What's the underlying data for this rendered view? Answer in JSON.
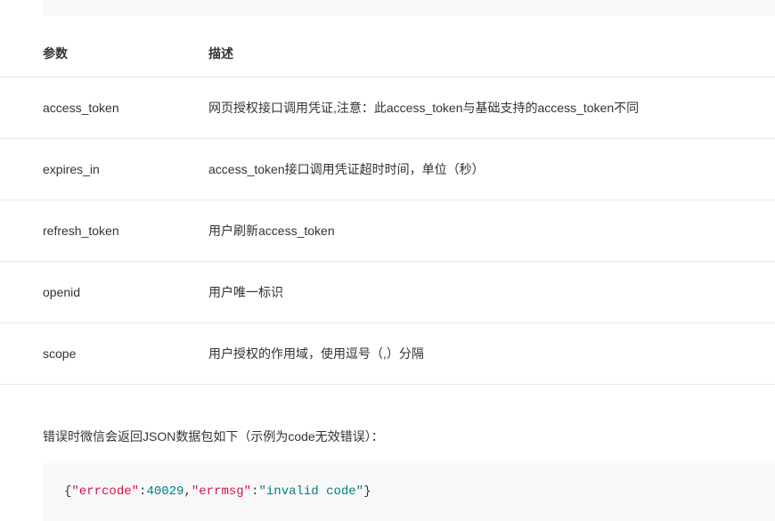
{
  "table": {
    "header": {
      "param": "参数",
      "desc": "描述"
    },
    "rows": [
      {
        "param": "access_token",
        "desc": "网页授权接口调用凭证,注意：此access_token与基础支持的access_token不同"
      },
      {
        "param": "expires_in",
        "desc": "access_token接口调用凭证超时时间，单位（秒）"
      },
      {
        "param": "refresh_token",
        "desc": "用户刷新access_token"
      },
      {
        "param": "openid",
        "desc": "用户唯一标识"
      },
      {
        "param": "scope",
        "desc": "用户授权的作用域，使用逗号（,）分隔"
      }
    ]
  },
  "note": "错误时微信会返回JSON数据包如下（示例为code无效错误）：",
  "code": {
    "brace_open": "{",
    "key1": "\"errcode\"",
    "colon1": ":",
    "val1": "40029",
    "comma": ",",
    "key2": "\"errmsg\"",
    "colon2": ":",
    "val2": "\"invalid code\"",
    "brace_close": "}"
  }
}
